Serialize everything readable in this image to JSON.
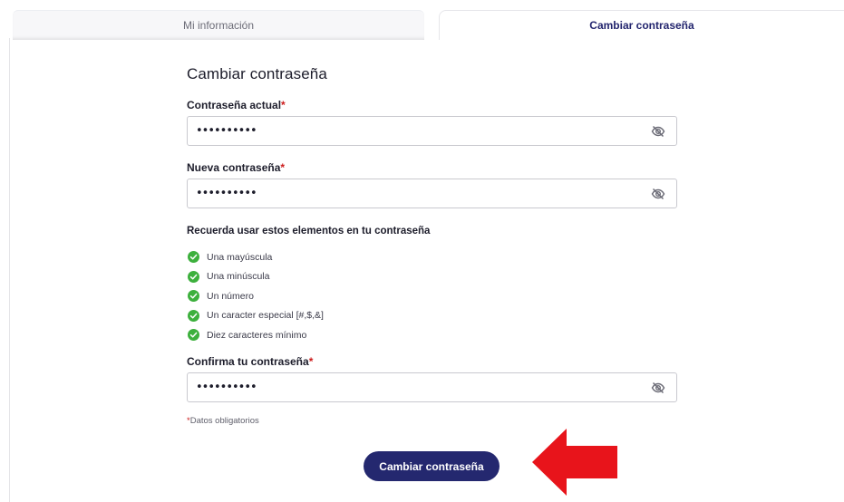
{
  "tabs": [
    {
      "label": "Mi información",
      "active": false
    },
    {
      "label": "Cambiar contraseña",
      "active": true
    }
  ],
  "form": {
    "title": "Cambiar contraseña",
    "required_mark": "*",
    "current_password": {
      "label": "Contraseña actual",
      "value": "••••••••••"
    },
    "new_password": {
      "label": "Nueva contraseña",
      "value": "••••••••••"
    },
    "confirm_password": {
      "label": "Confirma tu contraseña",
      "value": "••••••••••"
    },
    "requirements_title": "Recuerda usar estos elementos en tu contraseña",
    "requirements": [
      {
        "label": "Una mayúscula",
        "met": true
      },
      {
        "label": "Una minúscula",
        "met": true
      },
      {
        "label": "Un número",
        "met": true
      },
      {
        "label": "Un caracter especial [#,$,&]",
        "met": true
      },
      {
        "label": "Diez caracteres mínimo",
        "met": true
      }
    ],
    "mandatory_note": "Datos obligatorios",
    "submit_label": "Cambiar contraseña"
  },
  "icons": {
    "visibility_toggle": "eye-off-icon",
    "requirement_check": "check-circle-icon",
    "annotation": "red-arrow-icon"
  },
  "colors": {
    "accent": "#24286f",
    "success": "#3db03d",
    "required": "#cc1b1b",
    "annotation": "#e8141b"
  }
}
